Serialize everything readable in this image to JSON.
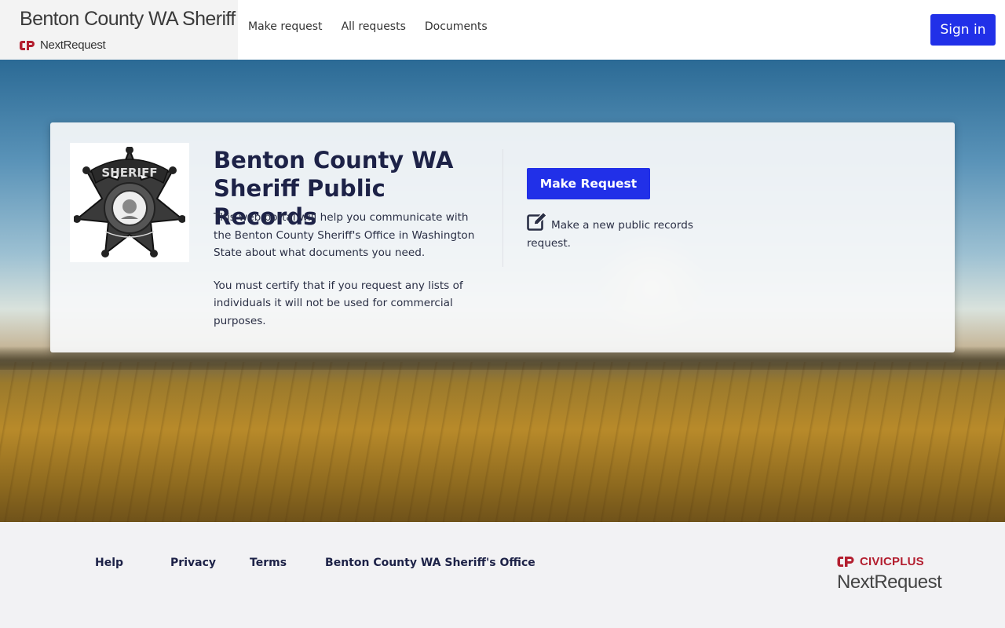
{
  "header": {
    "agency_title": "Benton County WA Sheriff",
    "product_name": "NextRequest",
    "nav": [
      {
        "label": "Make request"
      },
      {
        "label": "All requests"
      },
      {
        "label": "Documents"
      }
    ],
    "sign_in_label": "Sign in"
  },
  "hero": {
    "title": "Benton County WA Sheriff Public Records",
    "description_1": "This web portal will help you communicate with the Benton County Sheriff's Office in Washington State about what documents you need.",
    "description_2": "You must certify that if you request any lists of individuals it will not be used for commercial purposes.",
    "make_request_label": "Make Request",
    "make_request_note": "Make a new public records request.",
    "badge_icon": "sheriff-star-badge",
    "edit_icon": "edit-square-icon"
  },
  "footer": {
    "links": [
      {
        "label": "Help"
      },
      {
        "label": "Privacy"
      },
      {
        "label": "Terms"
      },
      {
        "label": "Benton County WA Sheriff's Office"
      }
    ],
    "civicplus_label": "CIVICPLUS",
    "nextrequest_label": "NextRequest"
  },
  "colors": {
    "primary_button": "#2130e8",
    "title_text": "#1d2247",
    "civicplus_red": "#b31e2f"
  }
}
